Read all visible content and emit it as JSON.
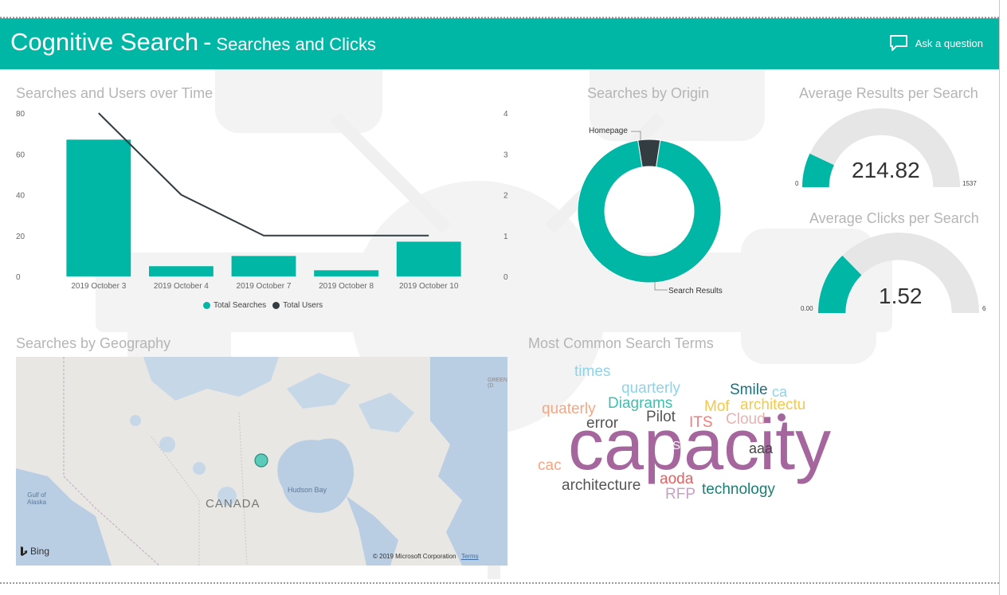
{
  "header": {
    "title": "Cognitive Search",
    "separator": "-",
    "subtitle": "Searches and Clicks",
    "ask_label": "Ask a question"
  },
  "sections": {
    "over_time": "Searches and Users over Time",
    "origin": "Searches by Origin",
    "avg_results": "Average Results per Search",
    "avg_clicks": "Average Clicks per Search",
    "geography": "Searches by Geography",
    "terms": "Most Common Search Terms"
  },
  "chart_data": [
    {
      "type": "bar",
      "title": "Searches and Users over Time",
      "categories": [
        "2019 October 3",
        "2019 October 4",
        "2019 October 7",
        "2019 October 8",
        "2019 October 10"
      ],
      "series": [
        {
          "name": "Total Searches",
          "type": "bar",
          "axis": "left",
          "values": [
            67,
            5,
            10,
            3,
            17
          ],
          "color": "#00b6a4"
        },
        {
          "name": "Total Users",
          "type": "line",
          "axis": "right",
          "values": [
            4,
            2,
            1,
            1,
            1
          ],
          "color": "#333c40"
        }
      ],
      "y_left": {
        "ticks": [
          "80",
          "60",
          "40",
          "20",
          "0"
        ],
        "range": [
          0,
          80
        ]
      },
      "y_right": {
        "ticks": [
          "4",
          "3",
          "2",
          "1",
          "0"
        ],
        "range": [
          0,
          4
        ]
      },
      "legend": "bottom-center"
    },
    {
      "type": "pie",
      "title": "Searches by Origin",
      "donut": true,
      "slices": [
        {
          "label": "Search Results",
          "value": 95,
          "color": "#00b6a4"
        },
        {
          "label": "Homepage",
          "value": 5,
          "color": "#333c40"
        }
      ]
    }
  ],
  "gauges": {
    "results": {
      "value": 214.82,
      "value_label": "214.82",
      "min_label": "0",
      "max_label": "1537",
      "min": 0,
      "max": 1537
    },
    "clicks": {
      "value": 1.52,
      "value_label": "1.52",
      "min_label": "0.00",
      "max_label": "6",
      "min": 0,
      "max": 6
    }
  },
  "map": {
    "labels": {
      "canada": "CANADA",
      "hudson": "Hudson Bay",
      "gulf": "Gulf of\nAlaska",
      "green": "GREEN\n(D"
    },
    "bing": "Bing",
    "copyright": "© 2019 Microsoft Corporation",
    "terms": "Terms"
  },
  "word_cloud": [
    {
      "text": "times",
      "color": "#8fd3e8"
    },
    {
      "text": "quarterly",
      "color": "#8fd3e8"
    },
    {
      "text": "Diagrams",
      "color": "#3fbfae"
    },
    {
      "text": "Smile",
      "color": "#1f6e7a"
    },
    {
      "text": "ca",
      "color": "#8fd3e8"
    },
    {
      "text": "quaterly",
      "color": "#f4a582"
    },
    {
      "text": "Mof",
      "color": "#f2c94c"
    },
    {
      "text": "architectu",
      "color": "#f2c94c"
    },
    {
      "text": "error",
      "color": "#555555"
    },
    {
      "text": "Pilot",
      "color": "#555555"
    },
    {
      "text": "ITS",
      "color": "#f47c7c"
    },
    {
      "text": "Cloud",
      "color": "#e6b3b3"
    },
    {
      "text": "capacity",
      "color": "#a5669e"
    },
    {
      "text": "SS",
      "color": "#ffffff"
    },
    {
      "text": "aaa",
      "color": "#444444"
    },
    {
      "text": "cac",
      "color": "#f4a582"
    },
    {
      "text": "architecture",
      "color": "#555555"
    },
    {
      "text": "aoda",
      "color": "#e85d5d"
    },
    {
      "text": "RFP",
      "color": "#c9a0c4"
    },
    {
      "text": "technology",
      "color": "#1a7f73"
    }
  ]
}
